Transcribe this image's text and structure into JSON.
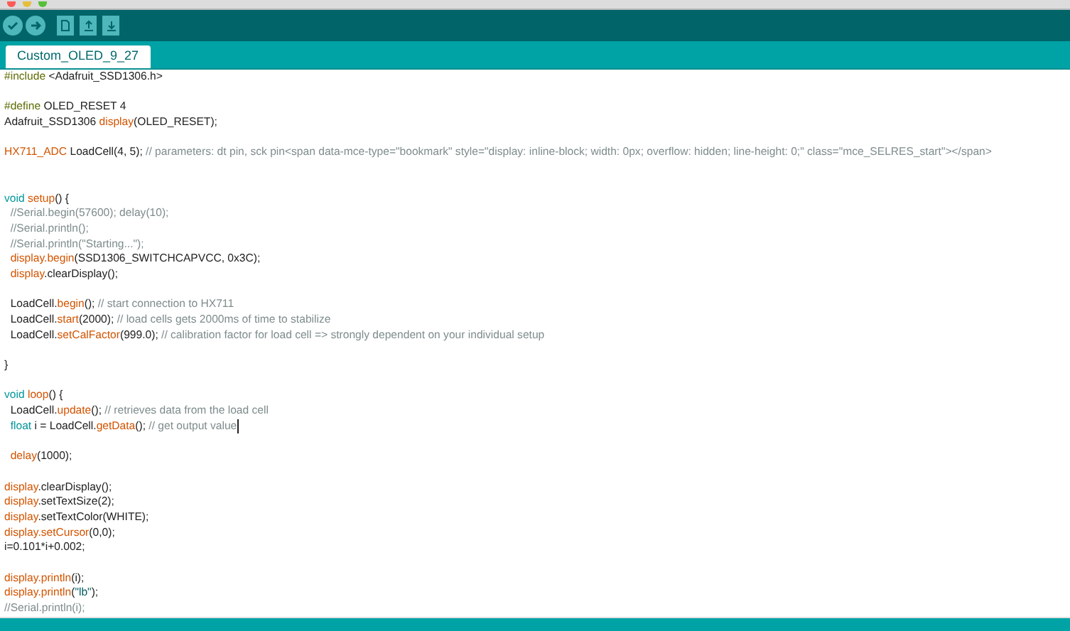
{
  "tab": {
    "label": "Custom_OLED_9_27",
    "selected": true
  },
  "lines": [
    {
      "kind": "code",
      "segments": [
        {
          "kind": "pre",
          "text": "#include"
        },
        {
          "kind": "plain",
          "text": " <Adafruit_SSD1306.h>"
        }
      ]
    },
    {
      "kind": "blank"
    },
    {
      "kind": "code",
      "segments": [
        {
          "kind": "pre",
          "text": "#define"
        },
        {
          "kind": "plain",
          "text": " OLED_RESET 4"
        }
      ]
    },
    {
      "kind": "code",
      "segments": [
        {
          "kind": "plain",
          "text": "Adafruit_SSD1306 "
        },
        {
          "kind": "fn",
          "text": "display"
        },
        {
          "kind": "plain",
          "text": "(OLED_RESET);"
        }
      ]
    },
    {
      "kind": "blank"
    },
    {
      "kind": "code",
      "segments": [
        {
          "kind": "fn",
          "text": "HX711_ADC"
        },
        {
          "kind": "plain",
          "text": " LoadCell(4, 5); "
        },
        {
          "kind": "comment",
          "text": "// parameters: dt pin, sck pin<span data-mce-type=\"bookmark\" style=\"display: inline-block; width: 0px; overflow: hidden; line-height: 0;\" class=\"mce_SELRES_start\"></span>"
        }
      ]
    },
    {
      "kind": "blank"
    },
    {
      "kind": "blank"
    },
    {
      "kind": "code",
      "segments": [
        {
          "kind": "kw",
          "text": "void "
        },
        {
          "kind": "fn",
          "text": "setup"
        },
        {
          "kind": "plain",
          "text": "() {"
        }
      ]
    },
    {
      "kind": "code",
      "segments": [
        {
          "kind": "comment",
          "text": "  //Serial.begin(57600); delay(10);"
        }
      ]
    },
    {
      "kind": "code",
      "segments": [
        {
          "kind": "comment",
          "text": "  //Serial.println();"
        }
      ]
    },
    {
      "kind": "code",
      "segments": [
        {
          "kind": "comment",
          "text": "  //Serial.println(\"Starting...\");"
        }
      ]
    },
    {
      "kind": "code",
      "segments": [
        {
          "kind": "fn",
          "text": "  display.begin"
        },
        {
          "kind": "plain",
          "text": "(SSD1306_SWITCHCAPVCC, 0x3C);"
        }
      ]
    },
    {
      "kind": "code",
      "segments": [
        {
          "kind": "fn",
          "text": "  display"
        },
        {
          "kind": "plain",
          "text": ".clearDisplay();"
        }
      ]
    },
    {
      "kind": "blank"
    },
    {
      "kind": "code",
      "segments": [
        {
          "kind": "plain",
          "text": "  LoadCell."
        },
        {
          "kind": "fn",
          "text": "begin"
        },
        {
          "kind": "plain",
          "text": "(); "
        },
        {
          "kind": "comment",
          "text": "// start connection to HX711"
        }
      ]
    },
    {
      "kind": "code",
      "segments": [
        {
          "kind": "plain",
          "text": "  LoadCell."
        },
        {
          "kind": "fn",
          "text": "start"
        },
        {
          "kind": "plain",
          "text": "(2000); "
        },
        {
          "kind": "comment",
          "text": "// load cells gets 2000ms of time to stabilize"
        }
      ]
    },
    {
      "kind": "code",
      "segments": [
        {
          "kind": "plain",
          "text": "  LoadCell."
        },
        {
          "kind": "fn",
          "text": "setCalFactor"
        },
        {
          "kind": "plain",
          "text": "(999.0); "
        },
        {
          "kind": "comment",
          "text": "// calibration factor for load cell => strongly dependent on your individual setup"
        }
      ]
    },
    {
      "kind": "blank"
    },
    {
      "kind": "code",
      "segments": [
        {
          "kind": "plain",
          "text": "}"
        }
      ]
    },
    {
      "kind": "blank"
    },
    {
      "kind": "code",
      "segments": [
        {
          "kind": "kw",
          "text": "void "
        },
        {
          "kind": "fn",
          "text": "loop"
        },
        {
          "kind": "plain",
          "text": "() {"
        }
      ]
    },
    {
      "kind": "code",
      "segments": [
        {
          "kind": "plain",
          "text": "  LoadCell."
        },
        {
          "kind": "fn",
          "text": "update"
        },
        {
          "kind": "plain",
          "text": "(); "
        },
        {
          "kind": "comment",
          "text": "// retrieves data from the load cell"
        }
      ]
    },
    {
      "kind": "code",
      "cursor": true,
      "segments": [
        {
          "kind": "kw",
          "text": "  float"
        },
        {
          "kind": "plain",
          "text": " i = LoadCell."
        },
        {
          "kind": "fn",
          "text": "getData"
        },
        {
          "kind": "plain",
          "text": "(); "
        },
        {
          "kind": "comment",
          "text": "// get output value"
        }
      ]
    },
    {
      "kind": "blank"
    },
    {
      "kind": "code",
      "segments": [
        {
          "kind": "fn",
          "text": "  delay"
        },
        {
          "kind": "plain",
          "text": "(1000);"
        }
      ]
    },
    {
      "kind": "blank"
    },
    {
      "kind": "code",
      "segments": [
        {
          "kind": "fn",
          "text": "display"
        },
        {
          "kind": "plain",
          "text": ".clearDisplay();"
        }
      ]
    },
    {
      "kind": "code",
      "segments": [
        {
          "kind": "fn",
          "text": "display"
        },
        {
          "kind": "plain",
          "text": ".setTextSize(2);"
        }
      ]
    },
    {
      "kind": "code",
      "segments": [
        {
          "kind": "fn",
          "text": "display"
        },
        {
          "kind": "plain",
          "text": ".setTextColor(WHITE);"
        }
      ]
    },
    {
      "kind": "code",
      "segments": [
        {
          "kind": "fn",
          "text": "display.setCursor"
        },
        {
          "kind": "plain",
          "text": "(0,0);"
        }
      ]
    },
    {
      "kind": "code",
      "segments": [
        {
          "kind": "plain",
          "text": "i=0.101*i+0.002;"
        }
      ]
    },
    {
      "kind": "blank"
    },
    {
      "kind": "code",
      "segments": [
        {
          "kind": "fn",
          "text": "display.println"
        },
        {
          "kind": "plain",
          "text": "(i);"
        }
      ]
    },
    {
      "kind": "code",
      "segments": [
        {
          "kind": "fn",
          "text": "display.println"
        },
        {
          "kind": "plain",
          "text": "("
        },
        {
          "kind": "str",
          "text": "\"lb\""
        },
        {
          "kind": "plain",
          "text": ");"
        }
      ]
    },
    {
      "kind": "code",
      "segments": [
        {
          "kind": "comment",
          "text": "//Serial.println(i);"
        }
      ]
    }
  ]
}
